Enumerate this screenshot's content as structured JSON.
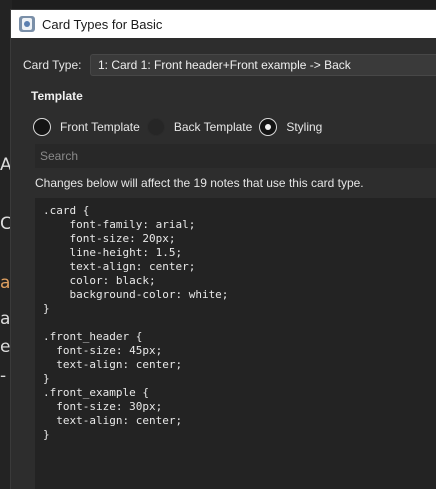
{
  "background_app": {
    "glyphs": [
      "A",
      "C",
      "a",
      "a",
      "e",
      "-"
    ]
  },
  "window": {
    "title": "Card Types for Basic",
    "app_icon": "anki-icon"
  },
  "card_type": {
    "label": "Card Type:",
    "selected": "1: Card 1: Front header+Front example -> Back"
  },
  "template": {
    "heading": "Template",
    "options": [
      {
        "label": "Front Template",
        "checked": false
      },
      {
        "label": "Back Template",
        "checked": false
      },
      {
        "label": "Styling",
        "checked": true
      }
    ]
  },
  "search": {
    "placeholder": "Search",
    "value": ""
  },
  "info": {
    "text": "Changes below will affect the 19 notes that use this card type."
  },
  "editor": {
    "lines": [
      ".card {",
      "    font-family: arial;",
      "    font-size: 20px;",
      "    line-height: 1.5;",
      "    text-align: center;",
      "    color: black;",
      "    background-color: white;",
      "}",
      "",
      ".front_header {",
      "  font-size: 45px;",
      "  text-align: center;",
      "}",
      ".front_example {",
      "  font-size: 30px;",
      "  text-align: center;",
      "}"
    ]
  }
}
